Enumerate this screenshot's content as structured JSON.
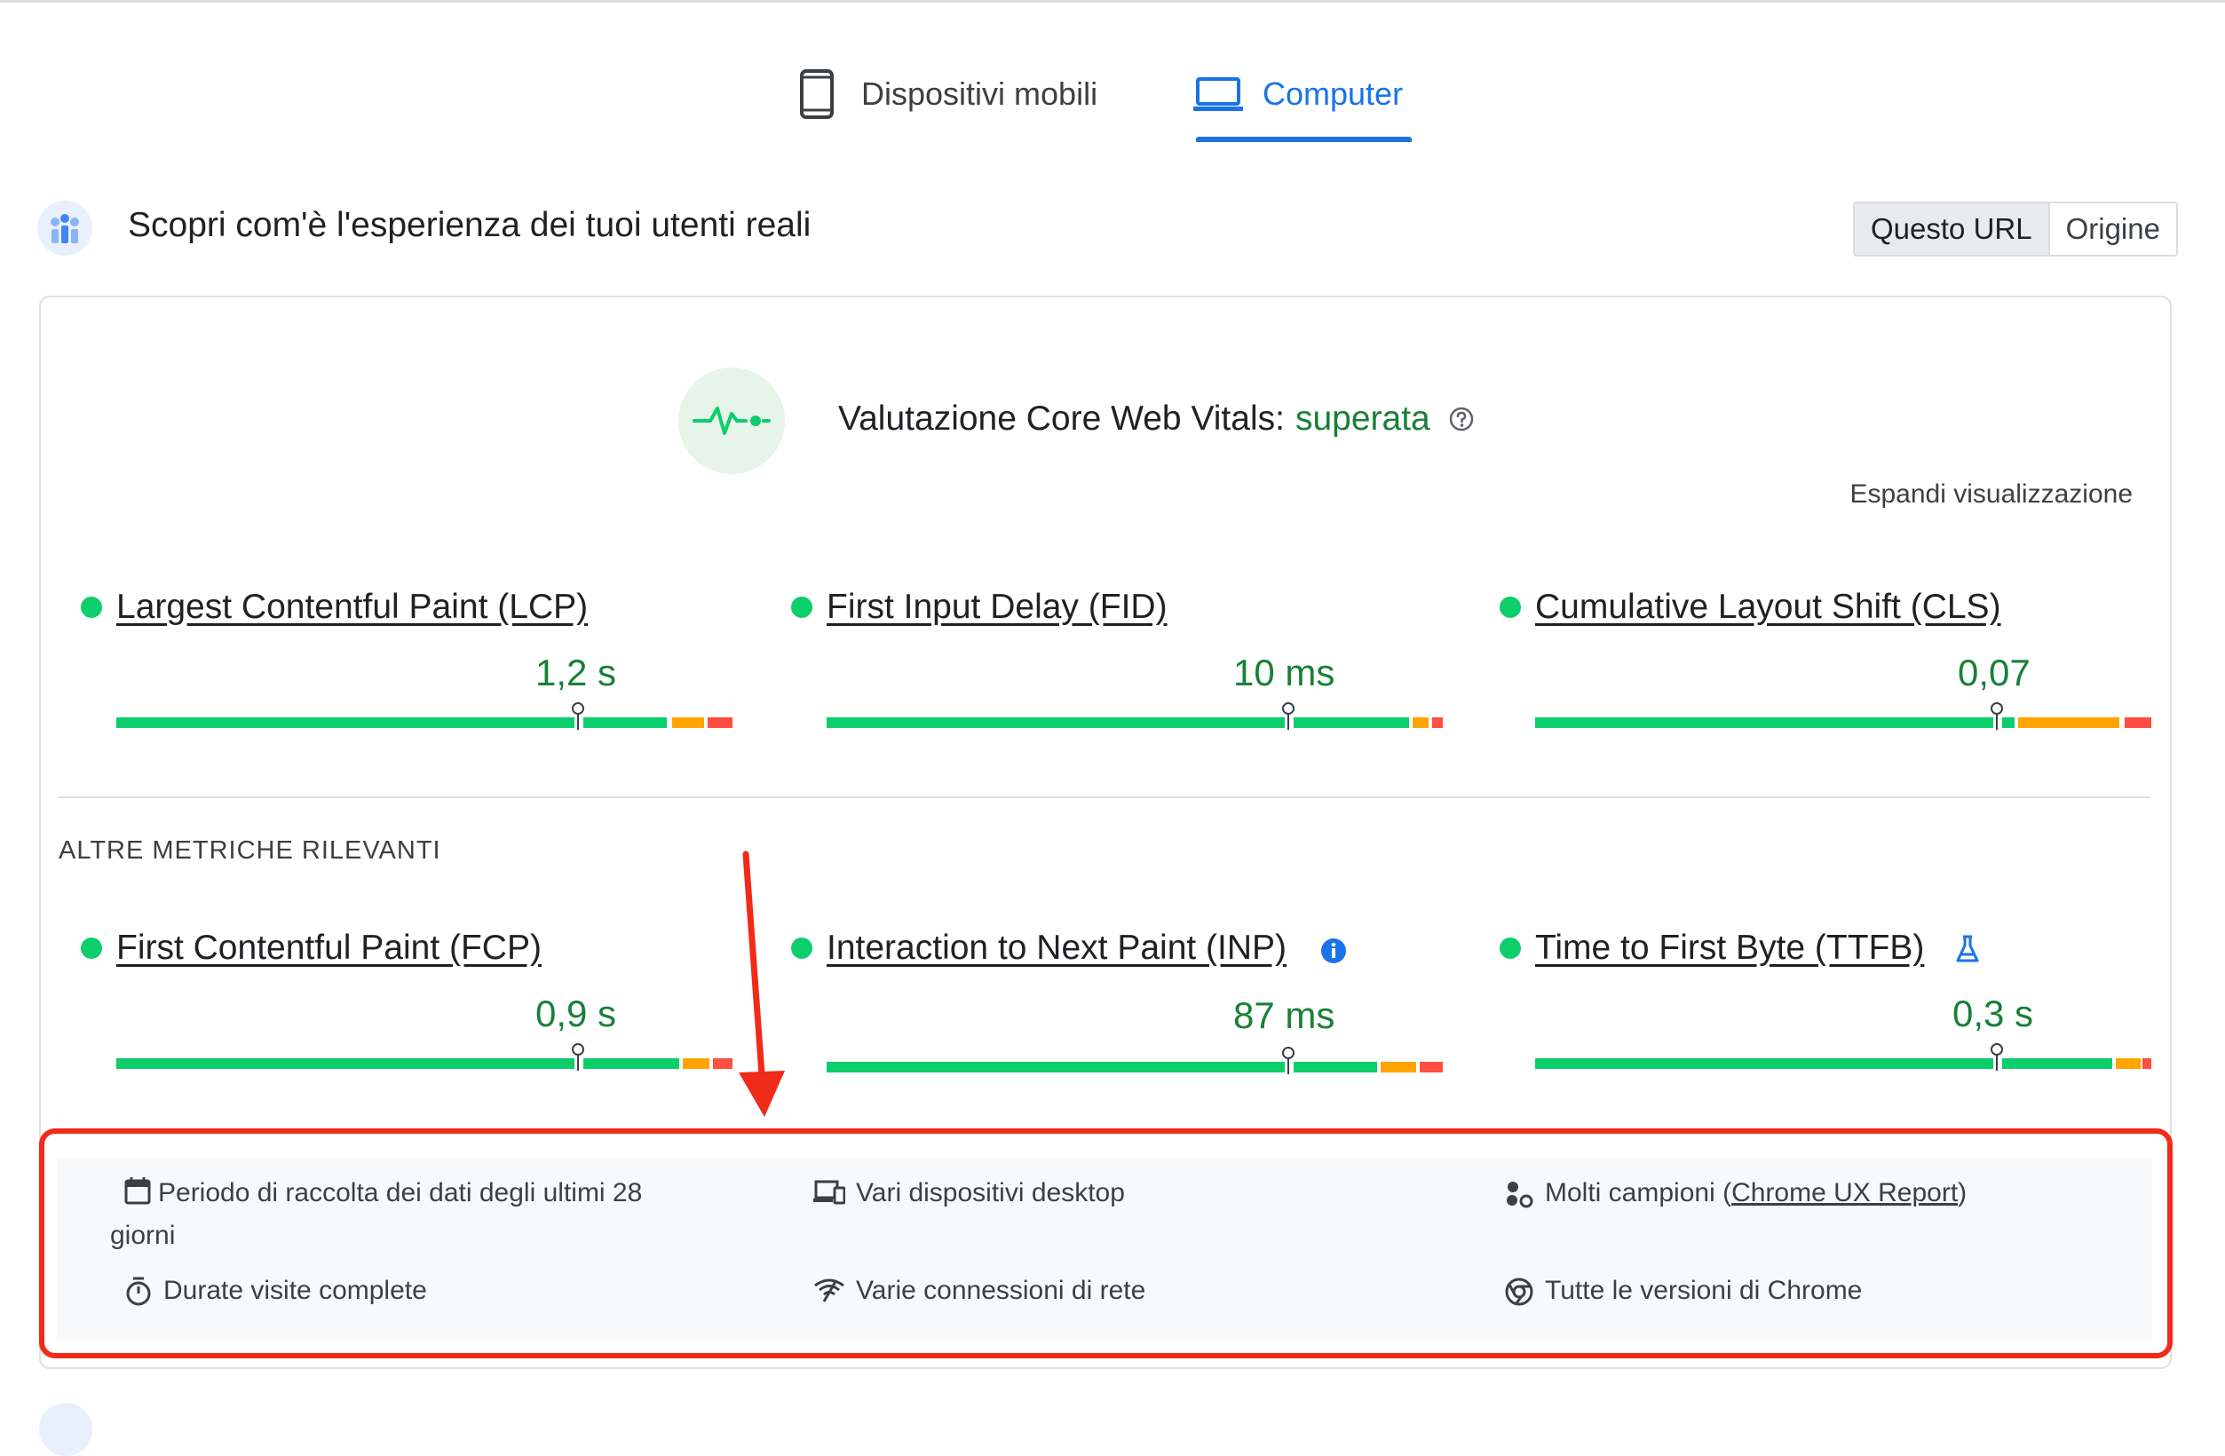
{
  "tabs": [
    {
      "label": "Dispositivi mobili",
      "icon": "smartphone-icon",
      "active": false
    },
    {
      "label": "Computer",
      "icon": "laptop-icon",
      "active": true
    }
  ],
  "section": {
    "title": "Scopri com'è l'esperienza dei tuoi utenti reali",
    "toggle": [
      "Questo URL",
      "Origine"
    ],
    "toggle_active": "Questo URL"
  },
  "cwv": {
    "label": "Valutazione Core Web Vitals:",
    "status": "superata",
    "expand": "Espandi visualizzazione"
  },
  "core_metrics": [
    {
      "name": "Largest Contentful Paint (LCP)",
      "value": "1,2 s"
    },
    {
      "name": "First Input Delay (FID)",
      "value": "10 ms"
    },
    {
      "name": "Cumulative Layout Shift (CLS)",
      "value": "0,07"
    }
  ],
  "other_label": "ALTRE METRICHE RILEVANTI",
  "other_metrics": [
    {
      "name": "First Contentful Paint (FCP)",
      "value": "0,9 s"
    },
    {
      "name": "Interaction to Next Paint (INP)",
      "value": "87 ms"
    },
    {
      "name": "Time to First Byte (TTFB)",
      "value": "0,3 s"
    }
  ],
  "info": {
    "period": "Periodo di raccolta dei dati degli ultimi 28 giorni",
    "devices": "Vari dispositivi desktop",
    "samples_prefix": "Molti campioni (",
    "samples_link": "Chrome UX Report",
    "samples_suffix": ")",
    "durations": "Durate visite complete",
    "connections": "Varie connessioni di rete",
    "versions": "Tutte le versioni di Chrome"
  },
  "colors": {
    "good": "#0cce6b",
    "good_text": "#188038",
    "needs_improvement": "#ffa400",
    "poor": "#ff4e42",
    "accent": "#1a73e8",
    "annotation": "#f02b18"
  }
}
